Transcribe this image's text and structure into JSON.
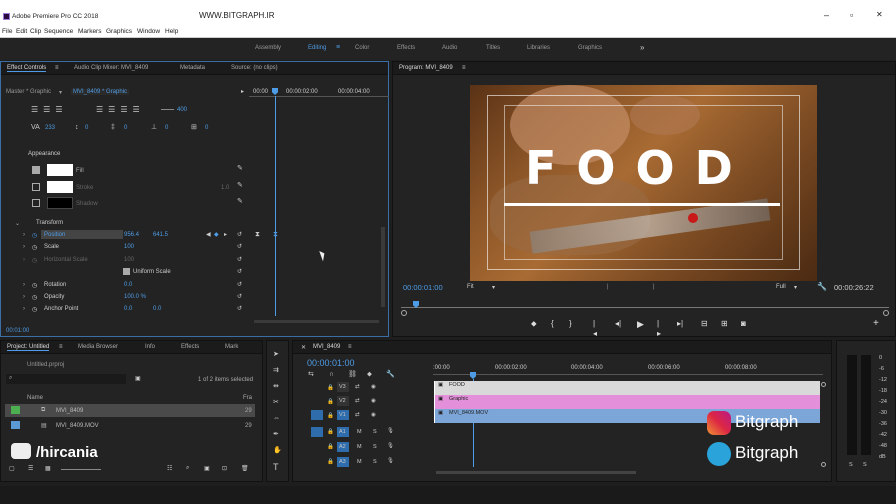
{
  "titlebar": {
    "app_title": "Adobe Premiere Pro CC 2018",
    "watermark": "WWW.BITGRAPH.IR",
    "min": "–",
    "max": "▫",
    "close": "✕"
  },
  "menu": [
    "File",
    "Edit",
    "Clip",
    "Sequence",
    "Markers",
    "Graphics",
    "Window",
    "Help"
  ],
  "workspaces": [
    "Assembly",
    "Editing",
    "Color",
    "Effects",
    "Audio",
    "Titles",
    "Libraries",
    "Graphics"
  ],
  "workspace_more": "»",
  "effect_controls": {
    "tabs": [
      "Effect Controls",
      "Audio Clip Mixer: MVI_8409",
      "Metadata",
      "Source: (no clips)"
    ],
    "master": "Master * Graphic",
    "clip": "MVI_8409 * Graphic",
    "time_marks": [
      "00:00",
      "00:00:02:00",
      "00:00:04:00"
    ],
    "font_size_value": "400",
    "tracking_values": [
      "233",
      "0",
      "0",
      "0",
      "0"
    ],
    "appearance_label": "Appearance",
    "fill_label": "Fill",
    "stroke_label": "Stroke",
    "stroke_value": "1.0",
    "shadow_label": "Shadow",
    "transform_label": "Transform",
    "position_label": "Position",
    "position_x": "956.4",
    "position_y": "641.5",
    "scale_label": "Scale",
    "scale_value": "100",
    "hscale_label": "Horizontal Scale",
    "hscale_value": "100",
    "uniform_scale_label": "Uniform Scale",
    "rotation_label": "Rotation",
    "rotation_value": "0.0",
    "opacity_label": "Opacity",
    "opacity_value": "100.0 %",
    "anchor_label": "Anchor Point",
    "anchor_x": "0.0",
    "anchor_y": "0.0",
    "footer_time": "00:01:00"
  },
  "program": {
    "title": "Program: MVI_8409",
    "menu": "≡",
    "overlay_text": "FOOD",
    "current_time": "00:00:01:00",
    "fit": "Fit",
    "quality": "Full",
    "duration": "00:00:26:22"
  },
  "project": {
    "tabs": [
      "Project: Untitled",
      "Media Browser",
      "Info",
      "Effects",
      "Mark"
    ],
    "file": "Untitled.prproj",
    "items_selected": "1 of 2 items selected",
    "col_name": "Name",
    "col_fps": "Fra",
    "items": [
      {
        "name": "MVI_8409",
        "fps": "29",
        "color": "#4caf50"
      },
      {
        "name": "MVI_8409.MOV",
        "fps": "29",
        "color": "#5b9bd5"
      }
    ],
    "hircania": "/hircania"
  },
  "timeline": {
    "seq_name": "MVI_8409",
    "time": "00:00:01:00",
    "ruler": [
      ":00:00",
      "00:00:02:00",
      "00:00:04:00",
      "00:00:06:00",
      "00:00:08:00"
    ],
    "tracks": [
      "V3",
      "V2",
      "V1",
      "A1",
      "A2",
      "A3"
    ],
    "clips": [
      {
        "label": "FOOD",
        "color": "#d9d9d9"
      },
      {
        "label": "Graphic",
        "color": "#e38fd9"
      },
      {
        "label": "MVI_8409.MOV",
        "color": "#7da6d8"
      }
    ],
    "meter_labels": [
      "0",
      "-6",
      "-12",
      "-18",
      "-24",
      "-30",
      "-36",
      "-42",
      "-48",
      "dB"
    ],
    "solo": [
      "S",
      "S"
    ]
  },
  "social": {
    "instagram": "Bitgraph",
    "telegram": "Bitgraph"
  }
}
